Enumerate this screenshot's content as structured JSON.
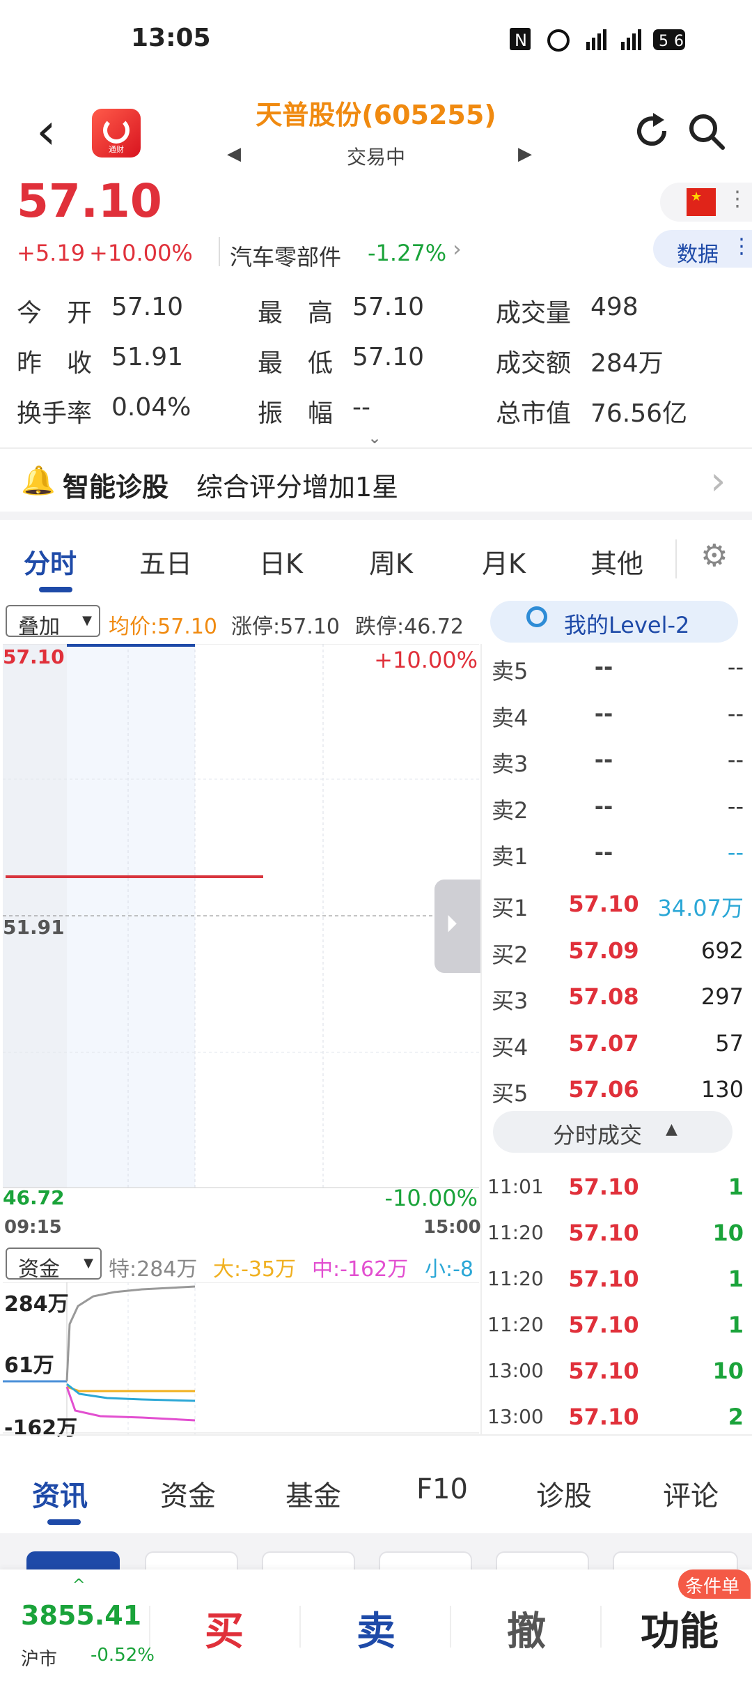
{
  "status_bar": {
    "time": "13:05",
    "icons_text": "N ⏰ 5G 5G 56",
    "battery": "56"
  },
  "header": {
    "stock_name": "天普股份(605255)",
    "market_state": "交易中",
    "logo_text": "通财"
  },
  "quote": {
    "price": "57.10",
    "change": "+5.19",
    "change_pct": "+10.00%",
    "sector": "汽车零部件",
    "sector_change": "-1.27%",
    "data_button": "数据"
  },
  "stats": [
    {
      "label": "今　开",
      "value": "57.10"
    },
    {
      "label": "最　高",
      "value": "57.10"
    },
    {
      "label": "成交量",
      "value": "498"
    },
    {
      "label": "昨　收",
      "value": "51.91"
    },
    {
      "label": "最　低",
      "value": "57.10"
    },
    {
      "label": "成交额",
      "value": "284万"
    },
    {
      "label": "换手率",
      "value": "0.04%"
    },
    {
      "label": "振　幅",
      "value": "--"
    },
    {
      "label": "总市值",
      "value": "76.56亿"
    }
  ],
  "diagnosis": {
    "title": "智能诊股",
    "text": "综合评分增加1星"
  },
  "chart_tabs": [
    "分时",
    "五日",
    "日K",
    "周K",
    "月K",
    "其他"
  ],
  "indicator": {
    "overlay": "叠加",
    "avg_price": "均价:57.10",
    "limit_up": "涨停:57.10",
    "limit_down": "跌停:46.72",
    "level2": "我的Level-2"
  },
  "chart_data": {
    "type": "line",
    "price_axis": {
      "high": "57.10",
      "mid": "51.91",
      "low": "46.72",
      "up_pct": "+10.00%",
      "down_pct": "-10.00%"
    },
    "time_axis": {
      "start": "09:15",
      "end": "15:00"
    },
    "ylim": [
      46.72,
      57.1
    ],
    "fund_flow": {
      "selector": "资金",
      "special": "特:284万",
      "big": "大:-35万",
      "mid": "中:-162万",
      "small": "小:-8",
      "y_labels": [
        "284万",
        "61万",
        "-162万"
      ]
    }
  },
  "order_book": {
    "asks": [
      {
        "label": "卖5",
        "price": "--",
        "volume": "--"
      },
      {
        "label": "卖4",
        "price": "--",
        "volume": "--"
      },
      {
        "label": "卖3",
        "price": "--",
        "volume": "--"
      },
      {
        "label": "卖2",
        "price": "--",
        "volume": "--"
      },
      {
        "label": "卖1",
        "price": "--",
        "volume": "--"
      }
    ],
    "bids": [
      {
        "label": "买1",
        "price": "57.10",
        "volume": "34.07万"
      },
      {
        "label": "买2",
        "price": "57.09",
        "volume": "692"
      },
      {
        "label": "买3",
        "price": "57.08",
        "volume": "297"
      },
      {
        "label": "买4",
        "price": "57.07",
        "volume": "57"
      },
      {
        "label": "买5",
        "price": "57.06",
        "volume": "130"
      }
    ],
    "trades_toggle": "分时成交",
    "trades": [
      {
        "time": "11:01",
        "price": "57.10",
        "volume": "1"
      },
      {
        "time": "11:20",
        "price": "57.10",
        "volume": "10"
      },
      {
        "time": "11:20",
        "price": "57.10",
        "volume": "1"
      },
      {
        "time": "11:20",
        "price": "57.10",
        "volume": "1"
      },
      {
        "time": "13:00",
        "price": "57.10",
        "volume": "10"
      },
      {
        "time": "13:00",
        "price": "57.10",
        "volume": "2"
      }
    ]
  },
  "bottom_tabs": [
    "资讯",
    "资金",
    "基金",
    "F10",
    "诊股",
    "评论"
  ],
  "action_bar": {
    "index_value": "3855.41",
    "index_name": "沪市",
    "index_change": "-0.52%",
    "buy": "买",
    "sell": "卖",
    "cancel": "撤",
    "function": "功能",
    "conditional_badge": "条件单"
  },
  "colors": {
    "up": "#e0303a",
    "down": "#1aa33a",
    "accent": "#1e4aa8",
    "name": "#f08a10"
  }
}
